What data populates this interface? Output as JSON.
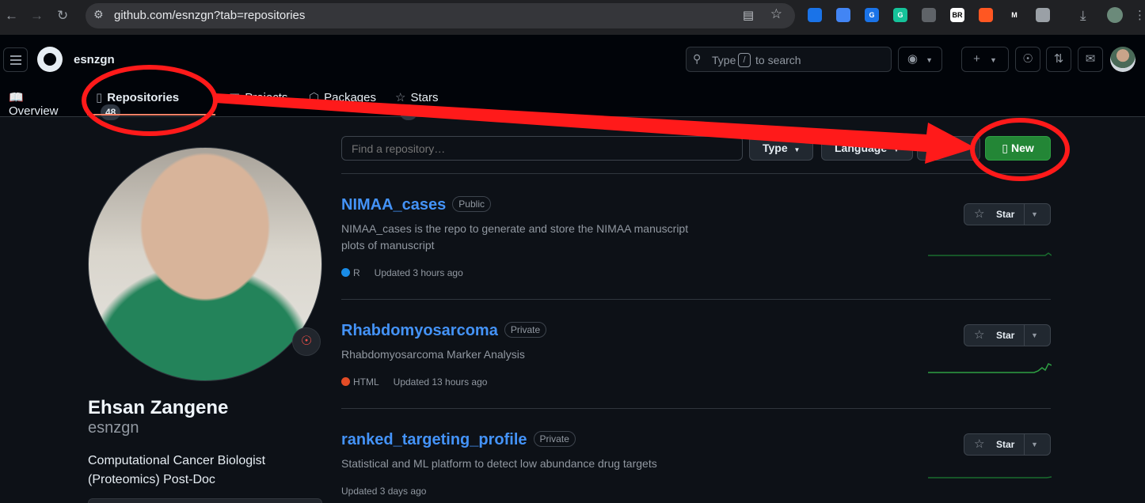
{
  "browser": {
    "url": "github.com/esnzgn?tab=repositories",
    "extensions": [
      {
        "name": "extension-1-icon",
        "label": "",
        "color": "#1a73e8"
      },
      {
        "name": "extension-2-icon",
        "label": "",
        "color": "#4285f4"
      },
      {
        "name": "google-translate-icon",
        "label": "G",
        "color": "#1a73e8"
      },
      {
        "name": "grammarly-icon",
        "label": "G",
        "color": "#15c39a"
      },
      {
        "name": "extension-5-icon",
        "label": "",
        "color": "#5f6368"
      },
      {
        "name": "extension-br-icon",
        "label": "BR",
        "color": "#ffffff"
      },
      {
        "name": "extension-7-icon",
        "label": "",
        "color": "#ff5722"
      },
      {
        "name": "extension-8-icon",
        "label": "M",
        "color": "#202124"
      },
      {
        "name": "puzzle-icon",
        "label": "",
        "color": "#9aa0a6"
      }
    ]
  },
  "header": {
    "username": "esnzgn",
    "search_type": "Type",
    "search_key": "/",
    "search_rest": "to search",
    "plus": "+"
  },
  "tabs": [
    {
      "label": "Overview",
      "icon": "book-icon"
    },
    {
      "label": "Repositories",
      "icon": "repo-icon",
      "count": "48"
    },
    {
      "label": "Projects",
      "icon": "table-icon"
    },
    {
      "label": "Packages",
      "icon": "package-icon"
    },
    {
      "label": "Stars",
      "icon": "star-icon",
      "count": "4"
    }
  ],
  "profile": {
    "full_name": "Ehsan Zangene",
    "login": "esnzgn",
    "bio": "Computational Cancer Biologist (Proteomics) Post-Doc",
    "status_emoji": "dart-icon"
  },
  "controls": {
    "find_placeholder": "Find a repository…",
    "type": "Type",
    "language": "Language",
    "new": "New"
  },
  "repos": [
    {
      "name": "NIMAA_cases",
      "visibility": "Public",
      "description": "NIMAA_cases is the repo to generate and store the NIMAA manuscript plots of manuscript",
      "language": "R",
      "language_color": "#198ce7",
      "updated": "Updated 3 hours ago",
      "star": "Star"
    },
    {
      "name": "Rhabdomyosarcoma",
      "visibility": "Private",
      "description": "Rhabdomyosarcoma Marker Analysis",
      "language": "HTML",
      "language_color": "#e34c26",
      "updated": "Updated 13 hours ago",
      "star": "Star"
    },
    {
      "name": "ranked_targeting_profile",
      "visibility": "Private",
      "description": "Statistical and ML platform to detect low abundance drug targets",
      "language": "",
      "language_color": "",
      "updated": "Updated 3 days ago",
      "star": "Star"
    }
  ],
  "annotation_color": "#ff1a1a"
}
